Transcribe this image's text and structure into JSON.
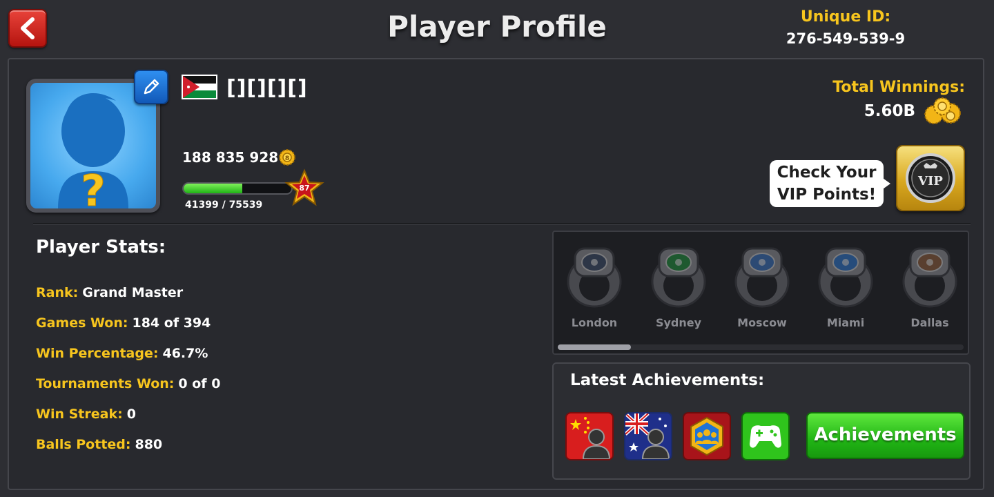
{
  "header": {
    "title": "Player Profile",
    "unique_id_label": "Unique ID:",
    "unique_id": "276-549-539-9"
  },
  "profile": {
    "name": "[][][][]",
    "flag": "jordan-flag",
    "coins": "188 835 928",
    "xp_text": "41399 / 75539",
    "xp_current": 41399,
    "xp_max": 75539,
    "level": "87"
  },
  "winnings": {
    "label": "Total Winnings:",
    "value": "5.60B"
  },
  "vip": {
    "bubble_line1": "Check Your",
    "bubble_line2": "VIP Points!",
    "badge": "VIP"
  },
  "stats": {
    "title": "Player Stats:",
    "rows": [
      {
        "label": "Rank:",
        "value": "Grand Master"
      },
      {
        "label": "Games Won:",
        "value": "184 of 394"
      },
      {
        "label": "Win Percentage:",
        "value": "46.7%"
      },
      {
        "label": "Tournaments Won:",
        "value": "0 of 0"
      },
      {
        "label": "Win Streak:",
        "value": "0"
      },
      {
        "label": "Balls Potted:",
        "value": "880"
      }
    ]
  },
  "rings": [
    {
      "label": "London",
      "gem": "#3b4a66"
    },
    {
      "label": "Sydney",
      "gem": "#1f8a3a"
    },
    {
      "label": "Moscow",
      "gem": "#3a6fb8"
    },
    {
      "label": "Miami",
      "gem": "#2f72c4"
    },
    {
      "label": "Dallas",
      "gem": "#8a5a3a"
    }
  ],
  "rings_scroll_fraction": 0.18,
  "achievements": {
    "title": "Latest Achievements:",
    "button_label": "Achievements",
    "icons": [
      "china-flag-silhouette-icon",
      "australia-flag-silhouette-icon",
      "club-members-hexagon-icon",
      "gamepad-icon"
    ]
  },
  "colors": {
    "accent_gold": "#f7c51e",
    "back_red": "#d32a22",
    "button_green": "#21b415",
    "edit_blue": "#1f73d6"
  }
}
